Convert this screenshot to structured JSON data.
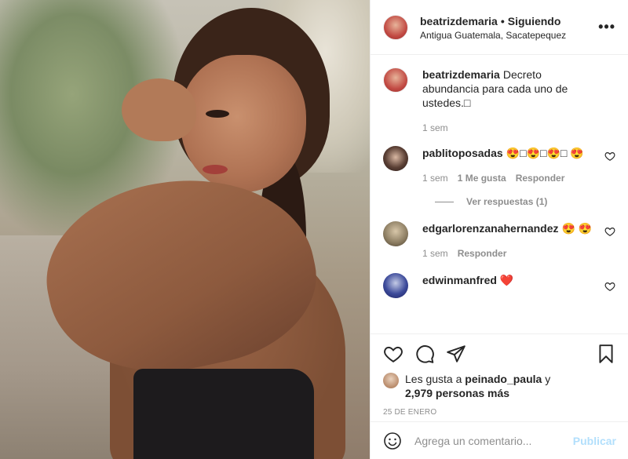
{
  "header": {
    "username": "beatrizdemaria",
    "separator": "•",
    "follow_status": "Siguiendo",
    "location": "Antigua Guatemala, Sacatepequez",
    "more_label": "•••"
  },
  "caption": {
    "username": "beatrizdemaria",
    "text": "Decreto abundancia para cada uno de ustedes.□",
    "time": "1 sem"
  },
  "comments": [
    {
      "username": "pablitoposadas",
      "text": "😍□😍□😍□ 😍",
      "time": "1 sem",
      "likes": "1 Me gusta",
      "reply": "Responder",
      "view_replies": "Ver respuestas (1)"
    },
    {
      "username": "edgarlorenzanahernandez",
      "text": "😍 😍",
      "time": "1 sem",
      "reply": "Responder"
    },
    {
      "username": "edwinmanfred",
      "text": "❤️"
    }
  ],
  "likes": {
    "prefix": "Les gusta a",
    "user": "peinado_paula",
    "joiner": "y",
    "others": "2,979 personas más"
  },
  "date": "25 DE ENERO",
  "add_comment": {
    "placeholder": "Agrega un comentario...",
    "publish": "Publicar"
  },
  "colors": {
    "publish_disabled": "#b2dffc",
    "meta_gray": "#8e8e8e",
    "text": "#262626"
  }
}
